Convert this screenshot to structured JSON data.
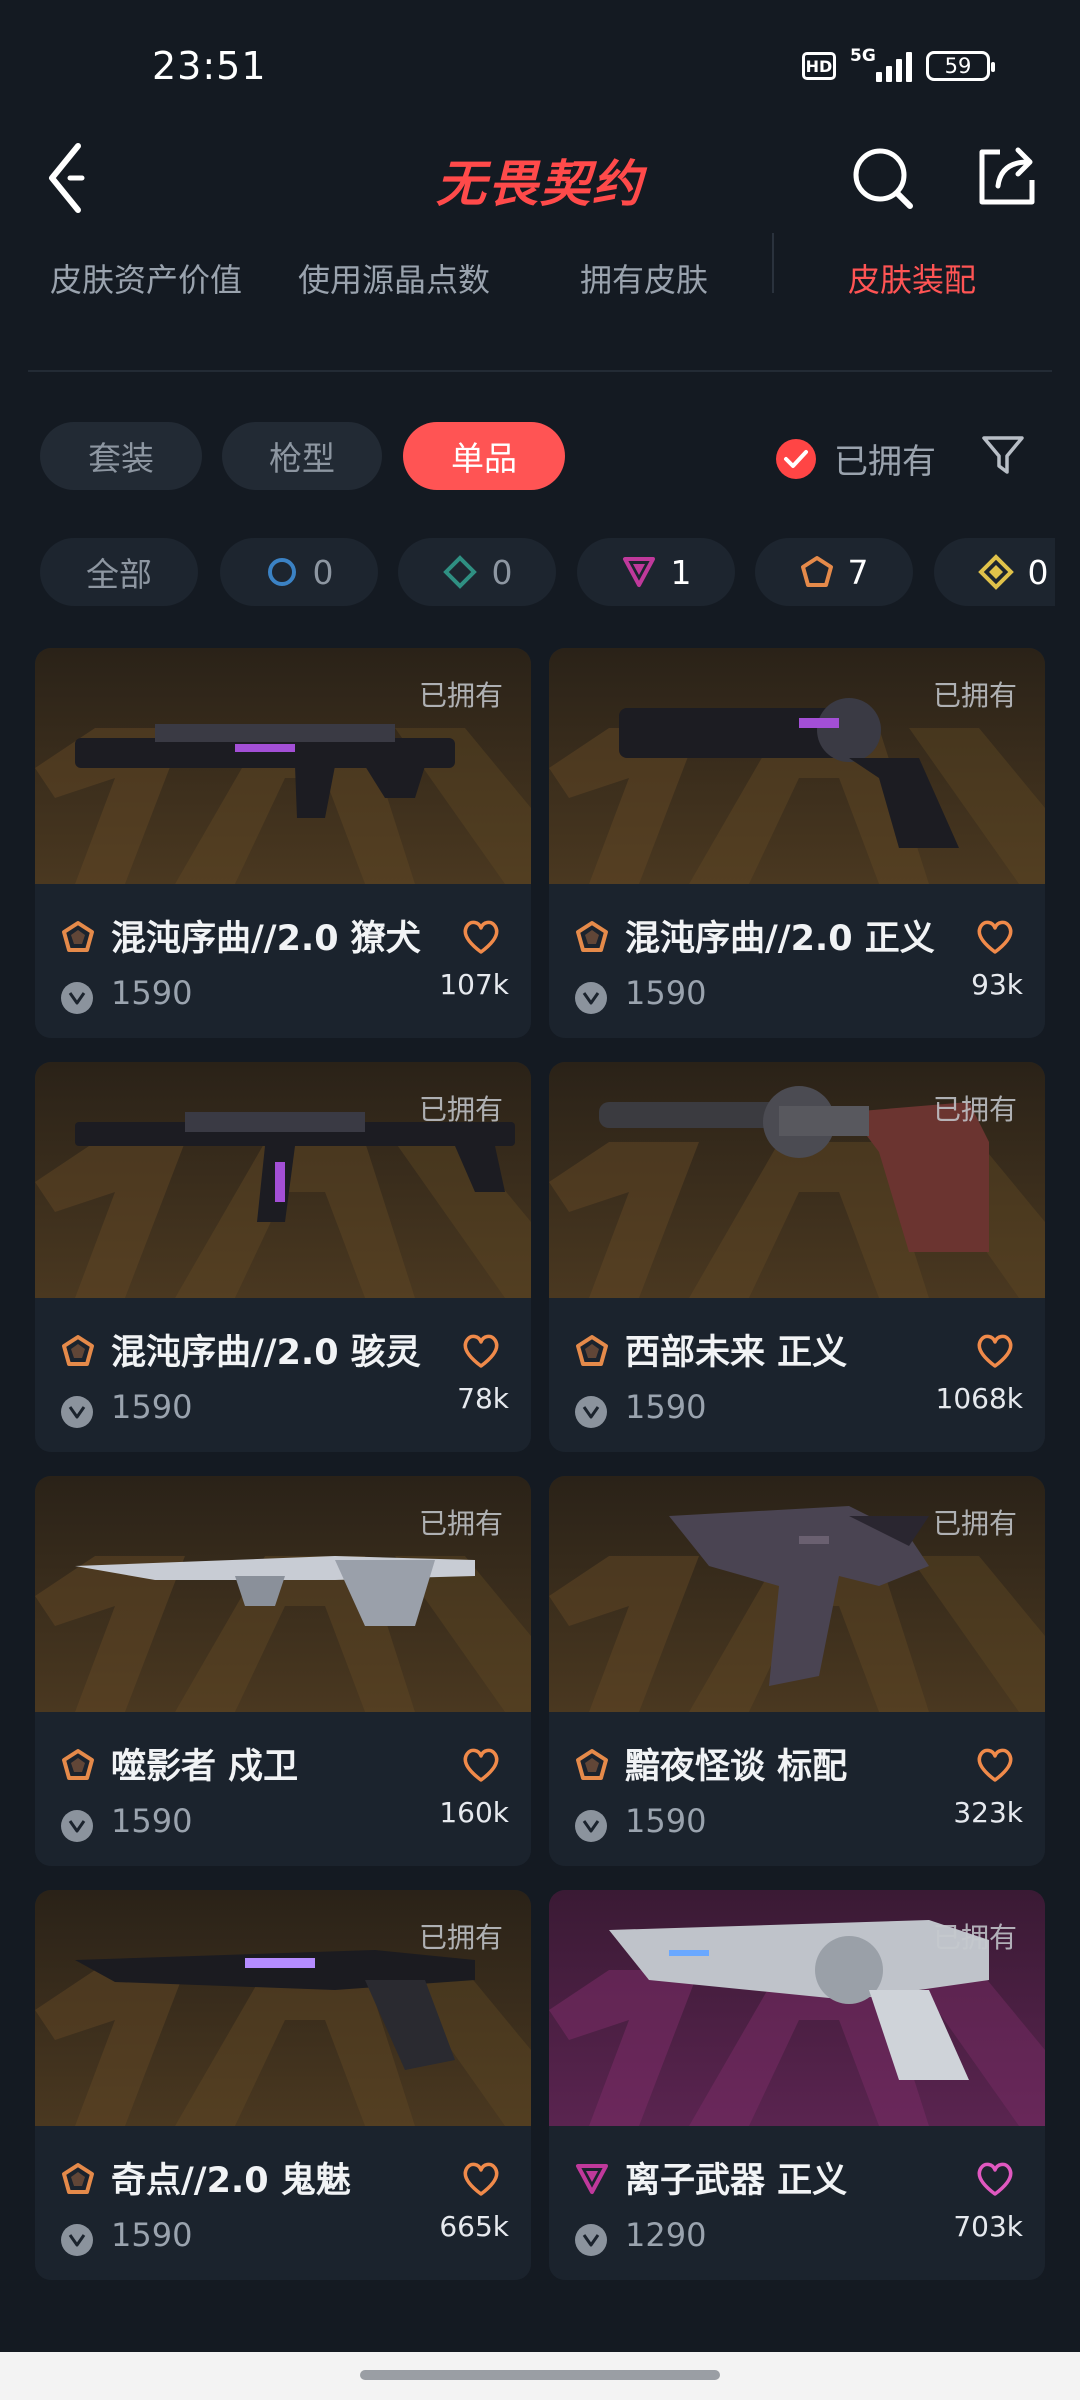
{
  "status": {
    "time": "23:51",
    "hd": "HD",
    "network": "5G",
    "battery": "59"
  },
  "header": {
    "title": "无畏契约"
  },
  "stat_tabs": [
    {
      "label": "皮肤资产价值"
    },
    {
      "label": "使用源晶点数"
    },
    {
      "label": "拥有皮肤"
    },
    {
      "label": "皮肤装配",
      "active": true
    }
  ],
  "type_filter": {
    "options": [
      "套装",
      "枪型",
      "单品"
    ],
    "active": "单品",
    "owned_label": "已拥有"
  },
  "tier_filter": {
    "all_label": "全部",
    "tiers": [
      {
        "name": "select",
        "count": "0",
        "color": "#3b82c4"
      },
      {
        "name": "deluxe",
        "count": "0",
        "color": "#2f8f82"
      },
      {
        "name": "premium",
        "count": "1",
        "color": "#c0399b"
      },
      {
        "name": "exclusive",
        "count": "7",
        "color": "#e58a4a"
      },
      {
        "name": "ultra",
        "count": "0",
        "color": "#e0c24a"
      }
    ]
  },
  "owned_badge": "已拥有",
  "cards": [
    {
      "name": "混沌序曲//2.0 獠犬",
      "price": "1590",
      "likes": "107k",
      "tier": "exclusive",
      "bg": "orange"
    },
    {
      "name": "混沌序曲//2.0 正义",
      "price": "1590",
      "likes": "93k",
      "tier": "exclusive",
      "bg": "orange"
    },
    {
      "name": "混沌序曲//2.0 骇灵",
      "price": "1590",
      "likes": "78k",
      "tier": "exclusive",
      "bg": "orange"
    },
    {
      "name": "西部未来 正义",
      "price": "1590",
      "likes": "1068k",
      "tier": "exclusive",
      "bg": "orange"
    },
    {
      "name": "噬影者 戍卫",
      "price": "1590",
      "likes": "160k",
      "tier": "exclusive",
      "bg": "orange"
    },
    {
      "name": "黯夜怪谈 标配",
      "price": "1590",
      "likes": "323k",
      "tier": "exclusive",
      "bg": "orange"
    },
    {
      "name": "奇点//2.0 鬼魅",
      "price": "1590",
      "likes": "665k",
      "tier": "exclusive",
      "bg": "orange"
    },
    {
      "name": "离子武器 正义",
      "price": "1290",
      "likes": "703k",
      "tier": "premium",
      "bg": "magenta"
    }
  ]
}
